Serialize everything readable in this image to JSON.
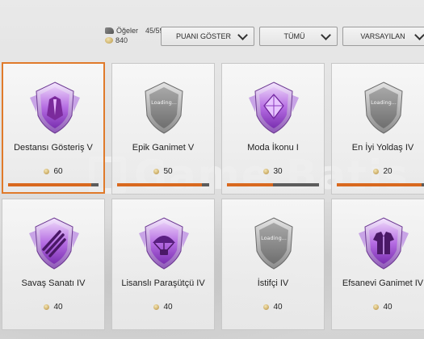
{
  "header": {
    "items_label": "Öğeler",
    "items_count": "45/59",
    "points": "840",
    "dropdowns": [
      {
        "label": "PUANI GÖSTER"
      },
      {
        "label": "TÜMÜ"
      },
      {
        "label": "VARSAYILAN"
      }
    ]
  },
  "watermark": "Game Batis",
  "cards": [
    {
      "name": "Destansı Gösteriş V",
      "price": "60",
      "progress": 0.92,
      "emblem": "purple-shield-cape-icon",
      "selected": true
    },
    {
      "name": "Epik Ganimet V",
      "price": "50",
      "progress": 0.92,
      "emblem": "loading-shield-icon",
      "loading_text": "Loading..."
    },
    {
      "name": "Moda İkonu I",
      "price": "30",
      "progress": 0.5,
      "emblem": "purple-shield-diamond-icon"
    },
    {
      "name": "En İyi Yoldaş IV",
      "price": "20",
      "progress": 0.92,
      "emblem": "loading-shield-icon",
      "loading_text": "Loading..."
    },
    {
      "name": "Savaş Sanatı IV",
      "price": "40",
      "emblem": "purple-shield-claw-icon"
    },
    {
      "name": "Lisanslı Paraşütçü IV",
      "price": "40",
      "emblem": "purple-shield-parachute-icon"
    },
    {
      "name": "İstifçi IV",
      "price": "40",
      "emblem": "loading-shield-icon",
      "loading_text": "Loading..."
    },
    {
      "name": "Efsanevi Ganimet IV",
      "price": "40",
      "emblem": "purple-shield-outfit-icon"
    }
  ],
  "colors": {
    "accent": "#e07a2a",
    "emblem_purple": "#a24fd8",
    "emblem_silver": "#9a9a9a"
  }
}
